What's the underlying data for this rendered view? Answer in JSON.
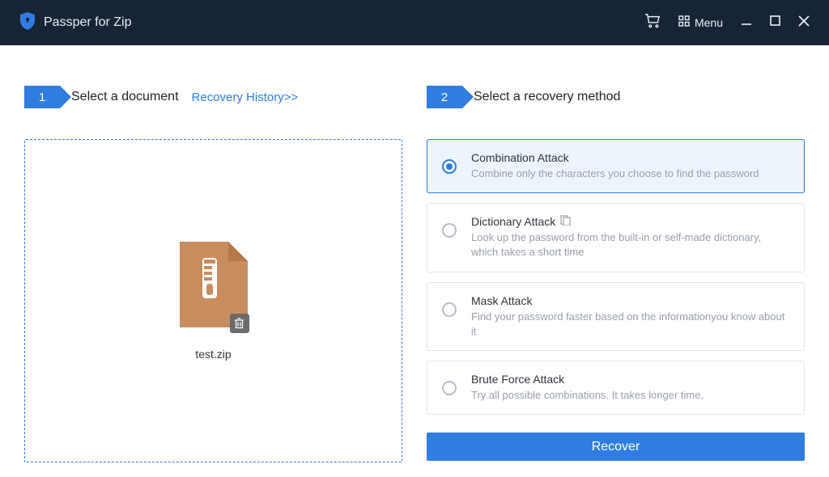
{
  "app": {
    "title": "Passper for Zip"
  },
  "header": {
    "menu_label": "Menu"
  },
  "step1": {
    "num": "1",
    "title": "Select a document",
    "history_link": "Recovery History>>",
    "file_name": "test.zip"
  },
  "step2": {
    "num": "2",
    "title": "Select a recovery method"
  },
  "methods": [
    {
      "title": "Combination Attack",
      "desc": "Combine only the characters you choose to find the password",
      "selected": true
    },
    {
      "title": "Dictionary Attack",
      "desc": "Look up the password from the built-in or self-made dictionary, which takes a short time",
      "selected": false,
      "has_icon": true
    },
    {
      "title": "Mask Attack",
      "desc": "Find your password faster based on the informationyou know about it",
      "selected": false
    },
    {
      "title": "Brute Force Attack",
      "desc": "Try all possible combinations. It takes longer time.",
      "selected": false
    }
  ],
  "recover_label": "Recover"
}
